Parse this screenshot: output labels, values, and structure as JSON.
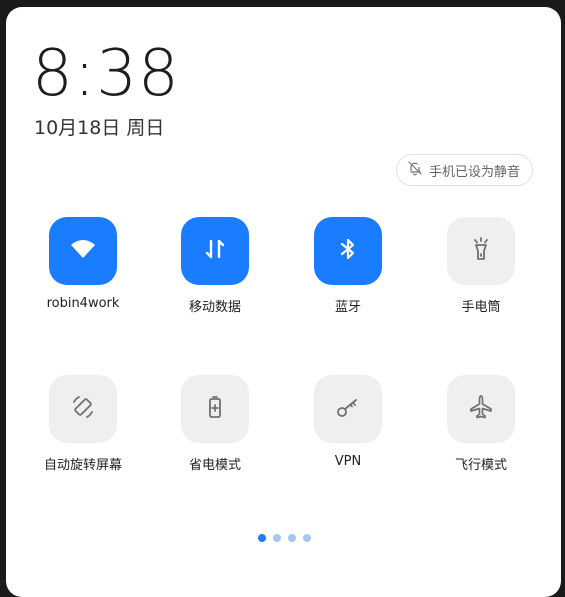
{
  "status": {
    "time": "8:38",
    "date": "10月18日 周日"
  },
  "silent_badge": {
    "label": "手机已设为静音",
    "icon": "bell-off-icon"
  },
  "tiles": [
    {
      "label": "robin4work",
      "icon": "wifi-icon",
      "state": "on"
    },
    {
      "label": "移动数据",
      "icon": "mobile-data-icon",
      "state": "on"
    },
    {
      "label": "蓝牙",
      "icon": "bluetooth-icon",
      "state": "on"
    },
    {
      "label": "手电筒",
      "icon": "flashlight-icon",
      "state": "off"
    },
    {
      "label": "自动旋转屏幕",
      "icon": "auto-rotate-icon",
      "state": "off"
    },
    {
      "label": "省电模式",
      "icon": "battery-saver-icon",
      "state": "off"
    },
    {
      "label": "VPN",
      "icon": "vpn-key-icon",
      "state": "off"
    },
    {
      "label": "飞行模式",
      "icon": "airplane-icon",
      "state": "off"
    }
  ],
  "pager": {
    "count": 4,
    "active": 1
  },
  "colors": {
    "accent": "#1a7cff",
    "tile_off": "#efefef",
    "icon_off": "#707070"
  }
}
